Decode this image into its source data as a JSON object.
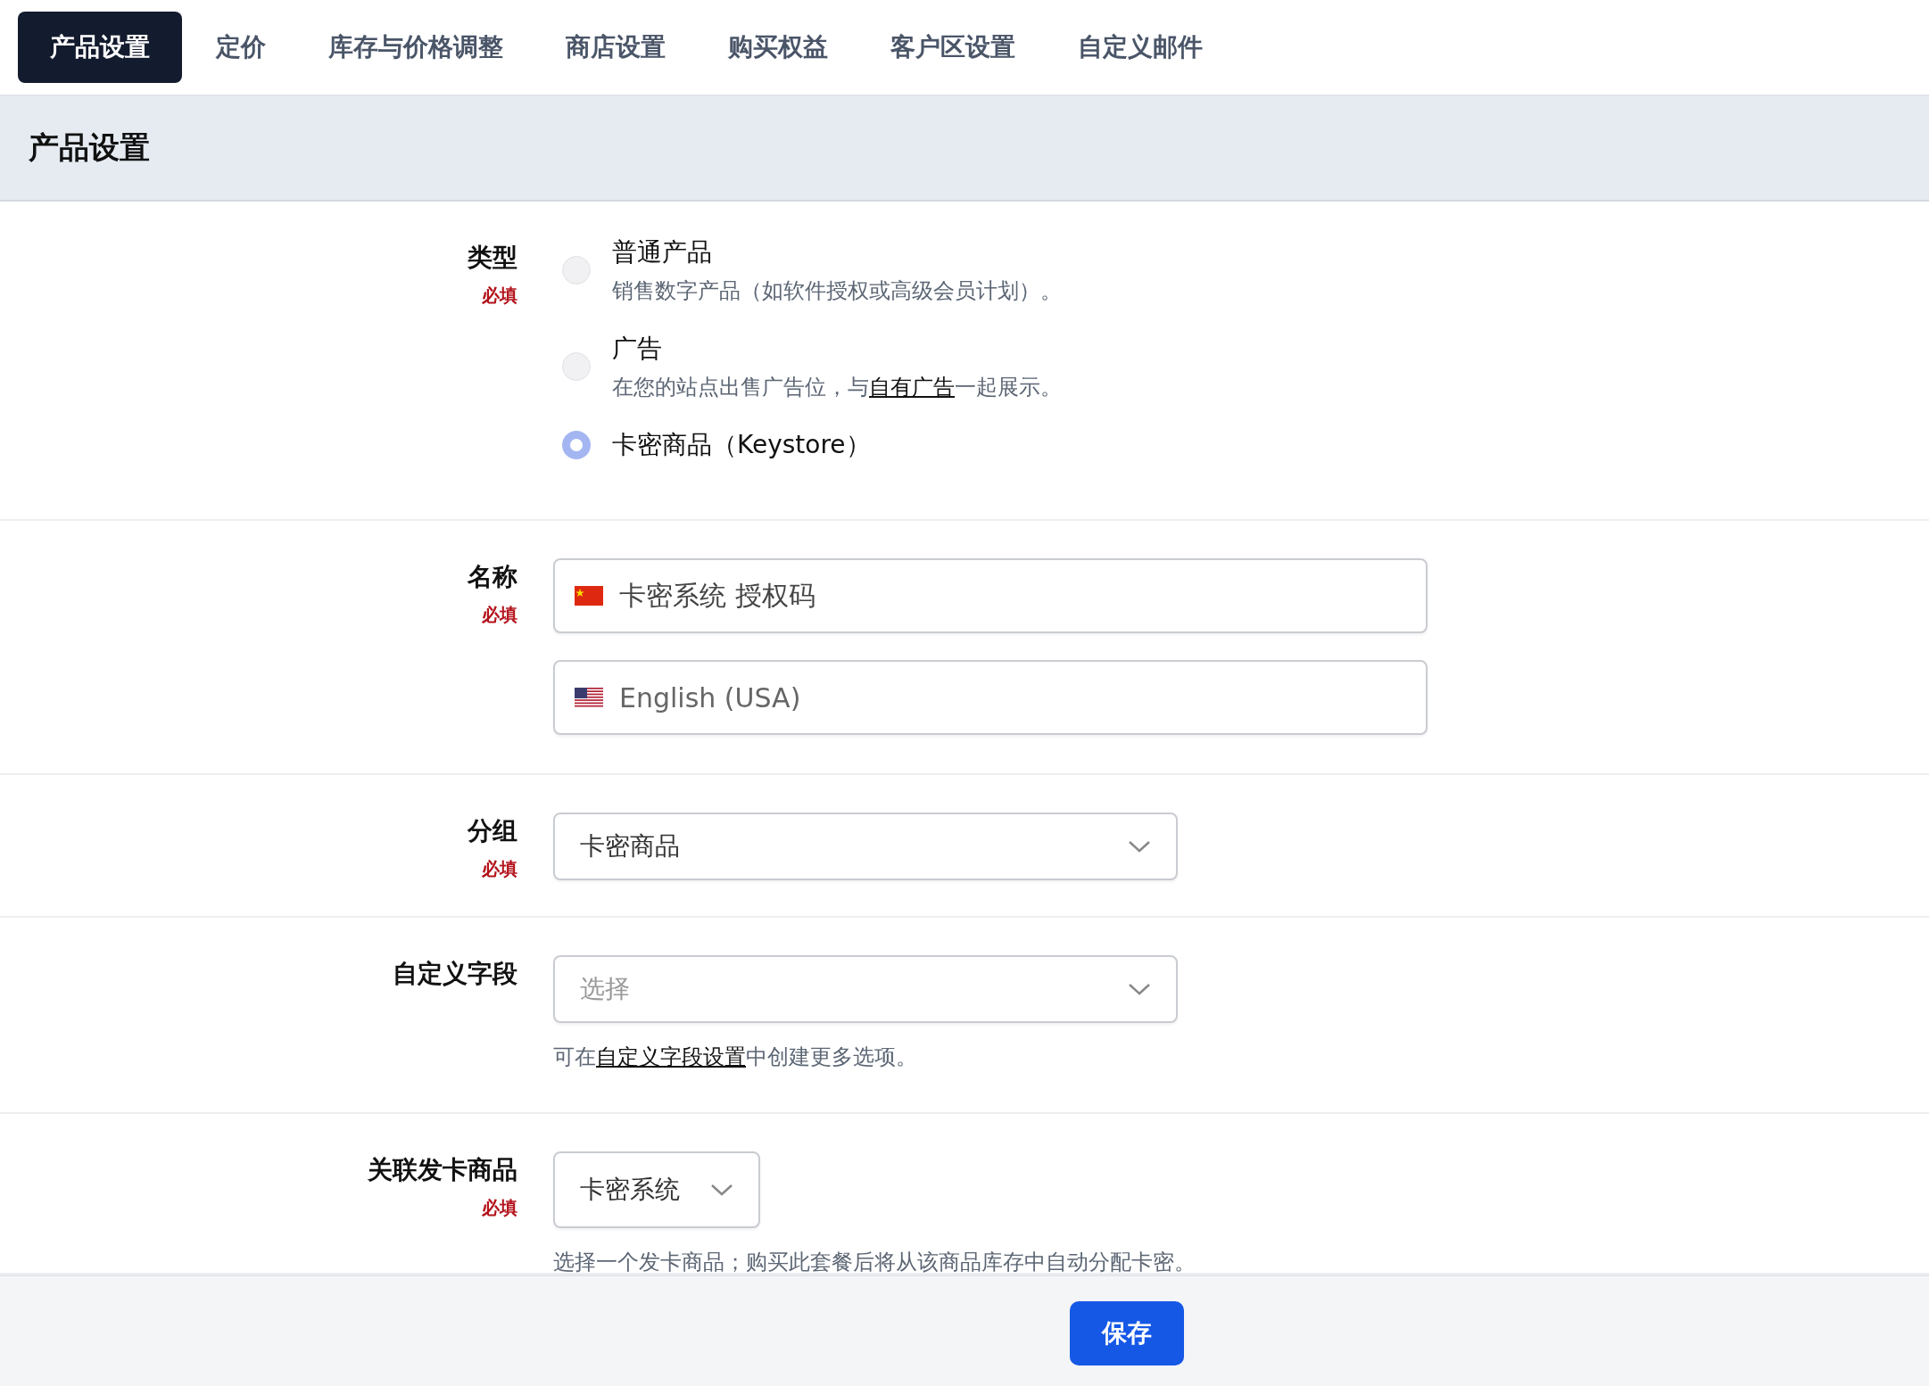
{
  "tabs": [
    {
      "label": "产品设置",
      "selected": true
    },
    {
      "label": "定价",
      "selected": false
    },
    {
      "label": "库存与价格调整",
      "selected": false
    },
    {
      "label": "商店设置",
      "selected": false
    },
    {
      "label": "购买权益",
      "selected": false
    },
    {
      "label": "客户区设置",
      "selected": false
    },
    {
      "label": "自定义邮件",
      "selected": false
    }
  ],
  "section_title": "产品设置",
  "fields": [
    {
      "kind": "radio",
      "label": "类型",
      "required_note": "必填",
      "options": [
        {
          "title": "普通产品",
          "description": {
            "text": "销售数字产品（如软件授权或高级会员计划）。"
          },
          "selected": false
        },
        {
          "title": "广告",
          "description": {
            "before": "在您的站点出售广告位，与",
            "link": "自有广告",
            "after": "一起展示。"
          },
          "selected": false
        },
        {
          "title": "卡密商品（Keystore）",
          "selected": true
        }
      ]
    },
    {
      "kind": "text",
      "label": "名称",
      "required_note": "必填",
      "inputs": [
        {
          "kind": "chinese",
          "value": "卡密系统 授权码"
        },
        {
          "kind": "english",
          "placeholder": "English (USA)"
        }
      ]
    },
    {
      "kind": "select",
      "label": "分组",
      "required_note": "必填",
      "value": "卡密商品"
    },
    {
      "kind": "select",
      "label": "自定义字段",
      "placeholder": "选择",
      "help": {
        "before": "可在",
        "link": "自定义字段设置",
        "after": "中创建更多选项。"
      }
    },
    {
      "kind": "picker",
      "label": "关联发卡商品",
      "required_note": "必填",
      "value": "卡密系统",
      "help": {
        "text": "选择一个发卡商品；购买此套餐后将从该商品库存中自动分配卡密。"
      }
    }
  ],
  "footer": {
    "save_button": "保存"
  }
}
